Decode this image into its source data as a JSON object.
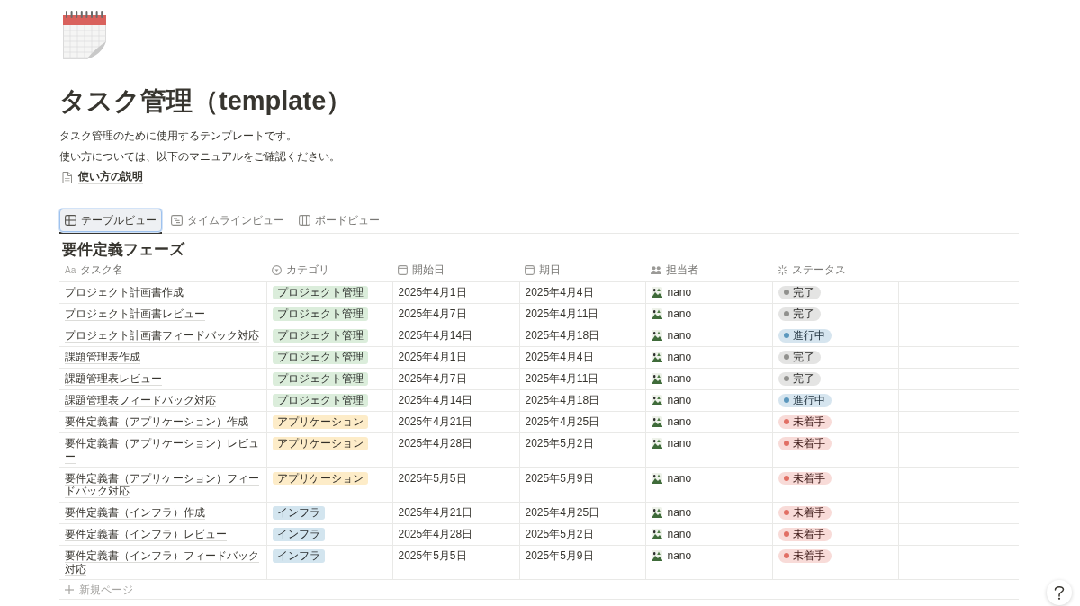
{
  "page": {
    "title": "タスク管理（template）",
    "description": [
      "タスク管理のために使用するテンプレートです。",
      "使い方については、以下のマニュアルをご確認ください。"
    ],
    "link": "使い方の説明"
  },
  "tabs": [
    {
      "label": "テーブルビュー",
      "kind": "table",
      "selected": true
    },
    {
      "label": "タイムラインビュー",
      "kind": "timeline",
      "selected": false
    },
    {
      "label": "ボードビュー",
      "kind": "board",
      "selected": false
    }
  ],
  "section": {
    "title": "要件定義フェーズ"
  },
  "table": {
    "columns": [
      {
        "label": "タスク名",
        "kind": "title",
        "icon_text": "Aa"
      },
      {
        "label": "カテゴリ",
        "kind": "select"
      },
      {
        "label": "開始日",
        "kind": "date"
      },
      {
        "label": "期日",
        "kind": "date"
      },
      {
        "label": "担当者",
        "kind": "person"
      },
      {
        "label": "ステータス",
        "kind": "status"
      }
    ],
    "rows": [
      {
        "cells": [
          "プロジェクト計画書作成",
          {
            "label": "プロジェクト管理",
            "color": "#dbeddb"
          },
          "2025年4月1日",
          "2025年4月4日",
          "nano",
          {
            "label": "完了",
            "color": "#91918e"
          }
        ]
      },
      {
        "cells": [
          "プロジェクト計画書レビュー",
          {
            "label": "プロジェクト管理",
            "color": "#dbeddb"
          },
          "2025年4月7日",
          "2025年4月11日",
          "nano",
          {
            "label": "完了",
            "color": "#91918e"
          }
        ]
      },
      {
        "cells": [
          "プロジェクト計画書フィードバック対応",
          {
            "label": "プロジェクト管理",
            "color": "#dbeddb"
          },
          "2025年4月14日",
          "2025年4月18日",
          "nano",
          {
            "label": "進行中",
            "color": "#5b97bd"
          }
        ]
      },
      {
        "cells": [
          "課題管理表作成",
          {
            "label": "プロジェクト管理",
            "color": "#dbeddb"
          },
          "2025年4月1日",
          "2025年4月4日",
          "nano",
          {
            "label": "完了",
            "color": "#91918e"
          }
        ]
      },
      {
        "cells": [
          "課題管理表レビュー",
          {
            "label": "プロジェクト管理",
            "color": "#dbeddb"
          },
          "2025年4月7日",
          "2025年4月11日",
          "nano",
          {
            "label": "完了",
            "color": "#91918e"
          }
        ]
      },
      {
        "cells": [
          "課題管理表フィードバック対応",
          {
            "label": "プロジェクト管理",
            "color": "#dbeddb"
          },
          "2025年4月14日",
          "2025年4月18日",
          "nano",
          {
            "label": "進行中",
            "color": "#5b97bd"
          }
        ]
      },
      {
        "cells": [
          "要件定義書（アプリケーション）作成",
          {
            "label": "アプリケーション",
            "color": "#fdecc8"
          },
          "2025年4月21日",
          "2025年4月25日",
          "nano",
          {
            "label": "未着手",
            "color": "#e16f64"
          }
        ]
      },
      {
        "cells": [
          "要件定義書（アプリケーション）レビュー",
          {
            "label": "アプリケーション",
            "color": "#fdecc8"
          },
          "2025年4月28日",
          "2025年5月2日",
          "nano",
          {
            "label": "未着手",
            "color": "#e16f64"
          }
        ]
      },
      {
        "cells": [
          "要件定義書（アプリケーション）フィードバック対応",
          {
            "label": "アプリケーション",
            "color": "#fdecc8"
          },
          "2025年5月5日",
          "2025年5月9日",
          "nano",
          {
            "label": "未着手",
            "color": "#e16f64"
          }
        ]
      },
      {
        "cells": [
          "要件定義書（インフラ）作成",
          {
            "label": "インフラ",
            "color": "#d3e5ef"
          },
          "2025年4月21日",
          "2025年4月25日",
          "nano",
          {
            "label": "未着手",
            "color": "#e16f64"
          }
        ]
      },
      {
        "cells": [
          "要件定義書（インフラ）レビュー",
          {
            "label": "インフラ",
            "color": "#d3e5ef"
          },
          "2025年4月28日",
          "2025年5月2日",
          "nano",
          {
            "label": "未着手",
            "color": "#e16f64"
          }
        ]
      },
      {
        "cells": [
          "要件定義書（インフラ）フィードバック対応",
          {
            "label": "インフラ",
            "color": "#d3e5ef"
          },
          "2025年5月5日",
          "2025年5月9日",
          "nano",
          {
            "label": "未着手",
            "color": "#e16f64"
          }
        ]
      }
    ],
    "new_row": "新規ページ"
  }
}
